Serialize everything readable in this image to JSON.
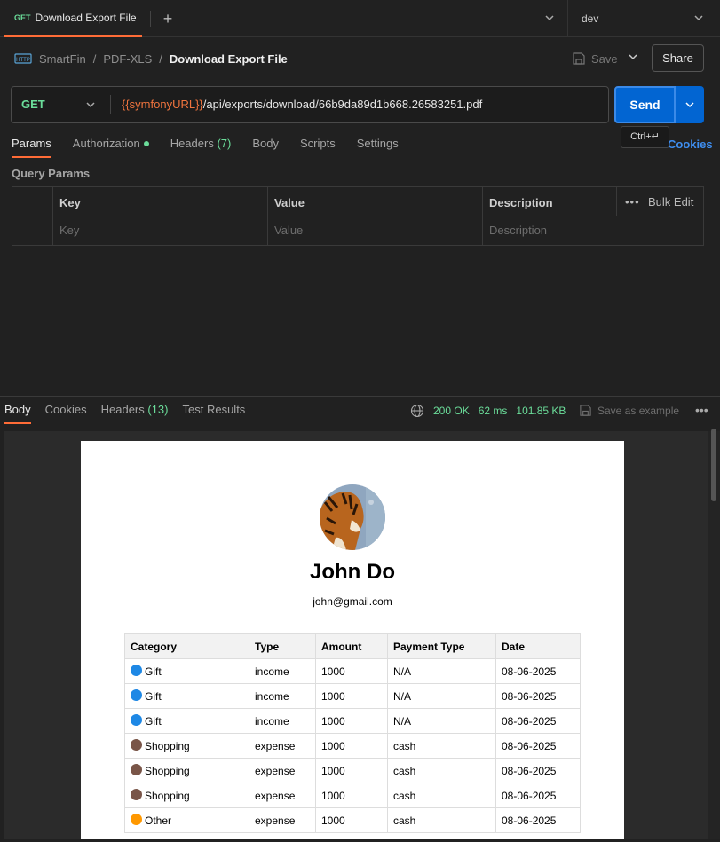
{
  "tab": {
    "method": "GET",
    "title": "Download Export File"
  },
  "environment": {
    "name": "dev"
  },
  "breadcrumb": {
    "items": [
      "SmartFin",
      "PDF-XLS"
    ],
    "current": "Download Export File"
  },
  "toolbar": {
    "save_label": "Save",
    "share_label": "Share"
  },
  "request": {
    "method": "GET",
    "url_var": "{{symfonyURL}}",
    "url_path": "/api/exports/download/66b9da89d1b668.26583251.pdf",
    "send_label": "Send",
    "send_tooltip": "Ctrl+↵",
    "cookies_label": "Cookies"
  },
  "request_tabs": {
    "params": "Params",
    "authorization": "Authorization",
    "headers": "Headers",
    "headers_count": "(7)",
    "body": "Body",
    "scripts": "Scripts",
    "settings": "Settings"
  },
  "query_params": {
    "title": "Query Params",
    "headers": {
      "key": "Key",
      "value": "Value",
      "description": "Description",
      "bulk_edit": "Bulk Edit"
    },
    "placeholders": {
      "key": "Key",
      "value": "Value",
      "description": "Description"
    }
  },
  "response_tabs": {
    "body": "Body",
    "cookies": "Cookies",
    "headers": "Headers",
    "headers_count": "(13)",
    "test_results": "Test Results"
  },
  "response_status": {
    "status": "200 OK",
    "time": "62 ms",
    "size": "101.85 KB",
    "save_example": "Save as example"
  },
  "pdf": {
    "name": "John Do",
    "email": "john@gmail.com",
    "columns": [
      "Category",
      "Type",
      "Amount",
      "Payment Type",
      "Date"
    ],
    "rows": [
      {
        "category": "Gift",
        "color": "#1e88e5",
        "type": "income",
        "amount": "1000",
        "payment": "N/A",
        "date": "08-06-2025"
      },
      {
        "category": "Gift",
        "color": "#1e88e5",
        "type": "income",
        "amount": "1000",
        "payment": "N/A",
        "date": "08-06-2025"
      },
      {
        "category": "Gift",
        "color": "#1e88e5",
        "type": "income",
        "amount": "1000",
        "payment": "N/A",
        "date": "08-06-2025"
      },
      {
        "category": "Shopping",
        "color": "#795548",
        "type": "expense",
        "amount": "1000",
        "payment": "cash",
        "date": "08-06-2025"
      },
      {
        "category": "Shopping",
        "color": "#795548",
        "type": "expense",
        "amount": "1000",
        "payment": "cash",
        "date": "08-06-2025"
      },
      {
        "category": "Shopping",
        "color": "#795548",
        "type": "expense",
        "amount": "1000",
        "payment": "cash",
        "date": "08-06-2025"
      },
      {
        "category": "Other",
        "color": "#ff9800",
        "type": "expense",
        "amount": "1000",
        "payment": "cash",
        "date": "08-06-2025"
      }
    ]
  },
  "colors": {
    "accent": "#ff6c37",
    "send": "#0265d2",
    "success": "#6bdd9a"
  }
}
